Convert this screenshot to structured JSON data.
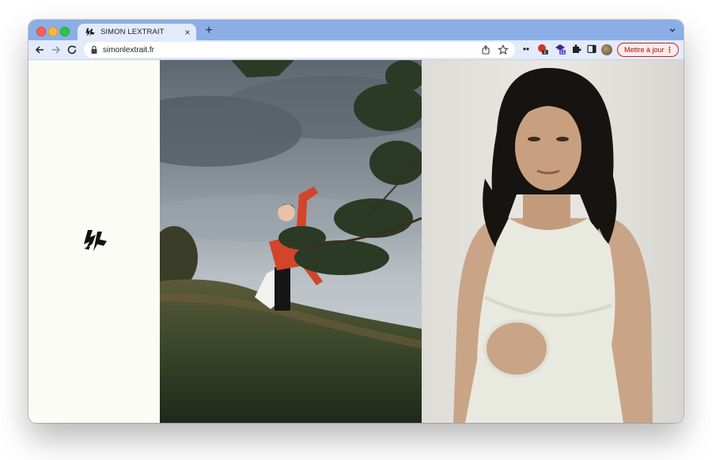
{
  "browser": {
    "tab": {
      "title": "SIMON LEXTRAIT",
      "close_glyph": "×"
    },
    "new_tab_glyph": "+",
    "url": "simonlextrait.fr",
    "update_button": {
      "label": "Mettre à jour",
      "menu_glyph": "⋮"
    },
    "extensions": [
      {
        "icon": "extension-dots-icon"
      },
      {
        "icon": "extension-red-badge-icon",
        "badge": "1"
      },
      {
        "icon": "extension-purple-badge-icon",
        "badge": "11"
      },
      {
        "icon": "puzzle-icon"
      },
      {
        "icon": "sidebar-icon"
      },
      {
        "icon": "profile-avatar"
      }
    ]
  },
  "page": {
    "logo_name": "simon-lextrait-logo",
    "background": "#fbfcf6",
    "images": [
      {
        "name": "man-in-red-sweater-under-pine-tree"
      },
      {
        "name": "portrait-woman-in-white-tank-top"
      }
    ]
  },
  "colors": {
    "tabbar": "#8caee6",
    "toolbar": "#e3ebfa",
    "update_border": "#c5221f",
    "update_text": "#a50e0e"
  }
}
